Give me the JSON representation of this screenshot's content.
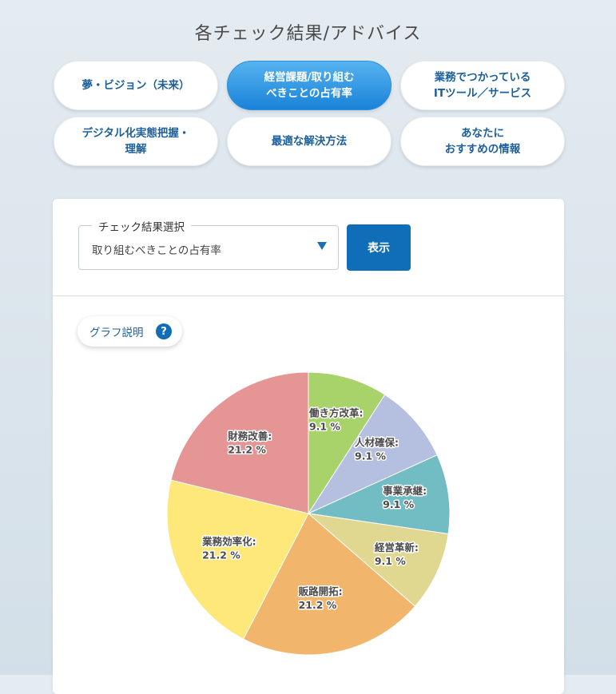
{
  "page": {
    "title": "各チェック結果/アドバイス"
  },
  "tabs": [
    {
      "label": "夢・ビジョン（未来）",
      "active": false
    },
    {
      "label": "経営課題/取り組む\nべきことの占有率",
      "active": true
    },
    {
      "label": "業務でつかっている\nITツール／サービス",
      "active": false
    },
    {
      "label": "デジタル化実態把握・\n理解",
      "active": false
    },
    {
      "label": "最適な解決方法",
      "active": false
    },
    {
      "label": "あなたに\nおすすめの情報",
      "active": false
    }
  ],
  "selector": {
    "legend": "チェック結果選択",
    "value": "取り組むべきことの占有率",
    "button_label": "表示"
  },
  "graph_help": {
    "label": "グラフ説明",
    "icon": "?"
  },
  "chart_data": {
    "type": "pie",
    "title": "",
    "slices": [
      {
        "label": "働き方改革:",
        "value": 9.1,
        "display": "9.1 %",
        "color": "#a8d26a"
      },
      {
        "label": "人材確保:",
        "value": 9.1,
        "display": "9.1 %",
        "color": "#b5c0e0"
      },
      {
        "label": "事業承継:",
        "value": 9.1,
        "display": "9.1 %",
        "color": "#72bcc3"
      },
      {
        "label": "経営革新:",
        "value": 9.1,
        "display": "9.1 %",
        "color": "#e0d890"
      },
      {
        "label": "販路開拓:",
        "value": 21.2,
        "display": "21.2 %",
        "color": "#f2b56c"
      },
      {
        "label": "業務効率化:",
        "value": 21.2,
        "display": "21.2 %",
        "color": "#fee87a"
      },
      {
        "label": "財務改善:",
        "value": 21.2,
        "display": "21.2 %",
        "color": "#e69595"
      }
    ]
  }
}
